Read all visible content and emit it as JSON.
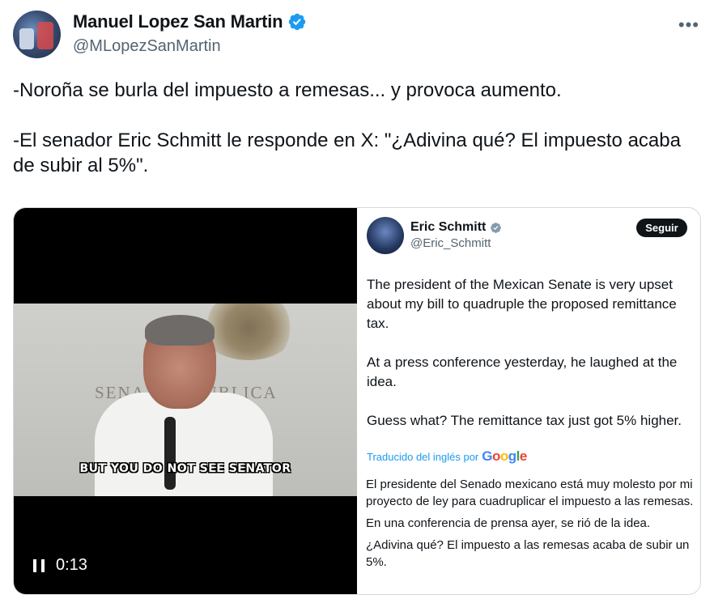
{
  "author": {
    "display_name": "Manuel Lopez San Martin",
    "handle": "@MLopezSanMartin",
    "verified": true,
    "more_icon": "more-dots-icon"
  },
  "tweet": {
    "text": "-Noroña se burla del impuesto a remesas... y provoca aumento.\n\n-El senador Eric Schmitt le responde en X: \"¿Adivina qué? El impuesto acaba de subir al 5%\"."
  },
  "video": {
    "wall_text": "SENA    A REPUBLICA",
    "caption": "BUT YOU DO NOT SEE SENATOR",
    "time": "0:13",
    "control_icon": "pause-icon"
  },
  "quoted": {
    "display_name": "Eric Schmitt",
    "handle": "@Eric_Schmitt",
    "verified": true,
    "follow_label": "Seguir",
    "body": [
      "The president of the Mexican Senate is very upset about my bill to quadruple the proposed remittance tax.",
      "At a press conference yesterday, he laughed at the idea.",
      "Guess what? The remittance tax just got 5% higher."
    ],
    "translated_label": "Traducido del inglés por",
    "translation_provider": "Google",
    "translation": [
      "El presidente del Senado mexicano está muy molesto por mi proyecto de ley para cuadruplicar el impuesto a las remesas.",
      "En una conferencia de prensa ayer, se rió de la idea.",
      "¿Adivina qué? El impuesto a las remesas acaba de subir un 5%."
    ]
  },
  "colors": {
    "verified_blue": "#1d9bf0",
    "text_primary": "#0f1419",
    "text_secondary": "#536471",
    "border": "#cfd9de"
  }
}
